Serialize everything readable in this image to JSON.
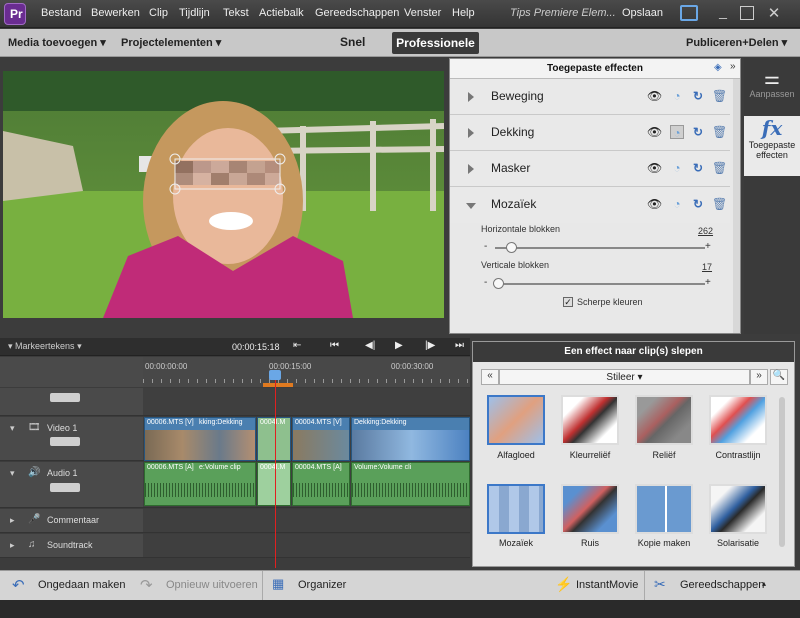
{
  "menubar": {
    "items": [
      "Bestand",
      "Bewerken",
      "Clip",
      "Tijdlijn",
      "Tekst",
      "Actiebalk",
      "Gereedschappen",
      "Venster",
      "Help"
    ],
    "app_title": "Tips Premiere Elem...",
    "save": "Opslaan"
  },
  "modebar": {
    "media_add": "Media toevoegen",
    "project_elements": "Projectelementen",
    "mode_quick": "Snel",
    "mode_pro": "Professionele",
    "publish": "Publiceren+Delen"
  },
  "effects_panel": {
    "title": "Toegepaste effecten",
    "effects": [
      "Beweging",
      "Dekking",
      "Masker",
      "Mozaïek"
    ],
    "mosaic": {
      "horizontal_label": "Horizontale blokken",
      "horizontal_value": "262",
      "vertical_label": "Verticale blokken",
      "vertical_value": "17",
      "checkbox_label": "Scherpe kleuren"
    }
  },
  "toolstrip": {
    "adjust": "Aanpassen",
    "applied_effects": "Toegepaste effecten"
  },
  "timeline": {
    "markers": "Markeertekens",
    "timecode": "00:00:15:18",
    "ruler": [
      "00:00:00:00",
      "00:00:15:00",
      "00:00:30:00"
    ],
    "tracks": {
      "video": "Video 1",
      "audio": "Audio 1",
      "commentary": "Commentaar",
      "soundtrack": "Soundtrack"
    },
    "video_clips": [
      "00006.MTS [V]",
      "kking:Dekking",
      "0004I.M",
      "00004.MTS [V]",
      "Dekking:Dekking"
    ],
    "audio_clips": [
      "00006.MTS [A]",
      "e:Volume clip",
      "0004I.M",
      "00004.MTS [A]",
      "Volume:Volume cli"
    ]
  },
  "browser": {
    "title": "Een effect naar clip(s) slepen",
    "category": "Stileer",
    "effects": [
      "Alfagloed",
      "Kleurreliëf",
      "Reliëf",
      "Contrastlijn",
      "Mozaïek",
      "Ruis",
      "Kopie maken",
      "Solarisatie"
    ]
  },
  "bottombar": {
    "undo": "Ongedaan maken",
    "redo": "Opnieuw uitvoeren",
    "organizer": "Organizer",
    "instant_movie": "InstantMovie",
    "tools": "Gereedschappen"
  }
}
